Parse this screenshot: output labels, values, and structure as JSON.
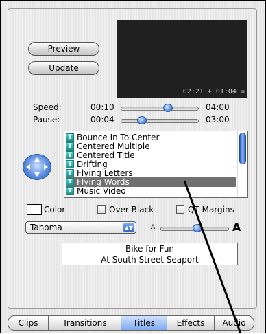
{
  "buttons": {
    "preview": "Preview",
    "update": "Update"
  },
  "preview": {
    "timecode": "02:21 + 01:04 ="
  },
  "speed": {
    "label": "Speed:",
    "min": "00:10",
    "max": "04:00",
    "level": 0.62
  },
  "pause": {
    "label": "Pause:",
    "min": "00:04",
    "max": "03:00",
    "level": 0.28
  },
  "titles_list": {
    "items": [
      "Bounce In To Center",
      "Centered Multiple",
      "Centered Title",
      "Drifting",
      "Flying Letters",
      "Flying Words",
      "Music Video"
    ],
    "selected": 5
  },
  "options": {
    "color": "Color",
    "over_black": "Over Black",
    "qt_margins": "QT Margins"
  },
  "font": {
    "name": "Tahoma",
    "size_small": "A",
    "size_large": "A",
    "size_level": 0.55
  },
  "text_lines": [
    "Bike for Fun",
    "At South Street Seaport"
  ],
  "tabs": [
    "Clips",
    "Transitions",
    "Titles",
    "Effects",
    "Audio"
  ],
  "active_tab": "Titles",
  "colors": {
    "accent": "#4a7fd6",
    "selection": "#707070"
  },
  "icon": "title-t-icon"
}
